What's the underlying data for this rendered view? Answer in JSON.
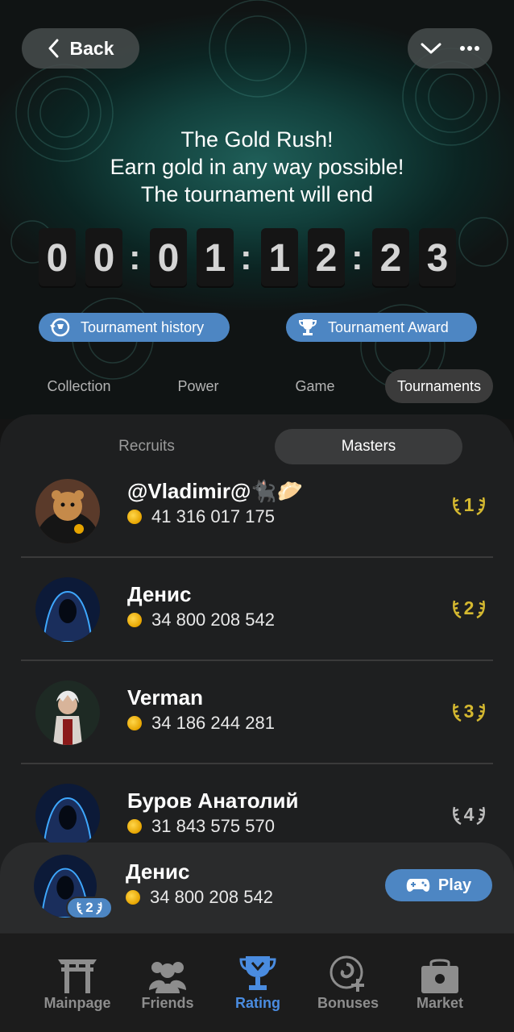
{
  "header": {
    "back_label": "Back",
    "title_line1": "The Gold Rush!",
    "title_line2": "Earn gold in any way possible!",
    "title_line3": "The tournament will end"
  },
  "timer": {
    "digits": [
      "0",
      "0",
      "0",
      "1",
      "1",
      "2",
      "2",
      "3"
    ],
    "separator": ":"
  },
  "actions": {
    "history_label": "Tournament history",
    "award_label": "Tournament Award"
  },
  "tabs": [
    {
      "label": "Collection"
    },
    {
      "label": "Power"
    },
    {
      "label": "Game"
    },
    {
      "label": "Tournaments"
    }
  ],
  "subtabs": [
    {
      "label": "Recruits"
    },
    {
      "label": "Masters"
    }
  ],
  "leaderboard": [
    {
      "name": "@Vladimir@🐈‍⬛🥟",
      "score": "41 316 017 175",
      "rank": "1",
      "avatar": "hamster-avatar"
    },
    {
      "name": "Денис",
      "score": "34 800 208 542",
      "rank": "2",
      "avatar": "hooded-avatar"
    },
    {
      "name": "Verman",
      "score": "34 186 244 281",
      "rank": "3",
      "avatar": "warrior-avatar"
    },
    {
      "name": "Буров Анатолий",
      "score": "31 843 575 570",
      "rank": "4",
      "avatar": "hooded-avatar"
    }
  ],
  "current_user": {
    "name": "Денис",
    "score": "34 800 208 542",
    "rank": "2",
    "play_label": "Play"
  },
  "nav": [
    {
      "label": "Mainpage",
      "icon": "gate-icon"
    },
    {
      "label": "Friends",
      "icon": "friends-icon"
    },
    {
      "label": "Rating",
      "icon": "trophy-icon"
    },
    {
      "label": "Bonuses",
      "icon": "spiral-plus-icon"
    },
    {
      "label": "Market",
      "icon": "bag-icon"
    }
  ],
  "colors": {
    "accent": "#4d86c3",
    "gold_rank": "#d4b830",
    "silver_rank": "#bdbdbd",
    "nav_active": "#4a8ce0"
  }
}
